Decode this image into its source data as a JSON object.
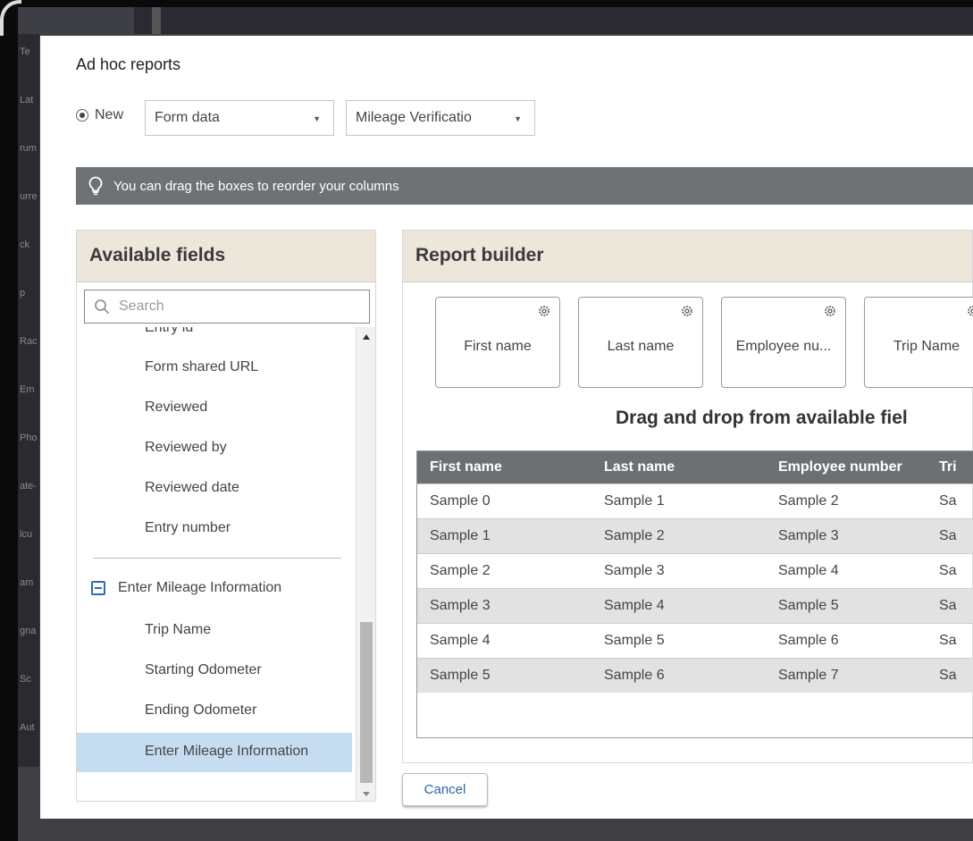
{
  "background_app": {
    "sidebar_items": [
      "Te",
      "Lat",
      "rum",
      "urre",
      "ck",
      "p",
      "Rac",
      "Em",
      "Pho",
      "ate-",
      "lcu",
      "am",
      "gna",
      "Sc",
      "Aut"
    ]
  },
  "dialog": {
    "title": "Ad hoc reports",
    "new_label": "New",
    "report_type_select": "Form data",
    "form_select": "Mileage Verificatio",
    "tip": "You can drag the boxes to reorder your columns"
  },
  "available_fields": {
    "header": "Available fields",
    "search_placeholder": "Search",
    "items": [
      "Entry id",
      "Form shared URL",
      "Reviewed",
      "Reviewed by",
      "Reviewed date",
      "Entry number"
    ],
    "group_label": "Enter Mileage Information",
    "group_items": [
      "Trip Name",
      "Starting Odometer",
      "Ending Odometer",
      "Enter Mileage Information"
    ]
  },
  "report_builder": {
    "header": "Report builder",
    "columns": [
      "First name",
      "Last name",
      "Employee nu...",
      "Trip Name"
    ],
    "drag_message": "Drag and drop from available fiel",
    "table": {
      "headers": [
        "First name",
        "Last name",
        "Employee number",
        "Tri"
      ],
      "rows": [
        [
          "Sample 0",
          "Sample 1",
          "Sample 2",
          "Sa"
        ],
        [
          "Sample 1",
          "Sample 2",
          "Sample 3",
          "Sa"
        ],
        [
          "Sample 2",
          "Sample 3",
          "Sample 4",
          "Sa"
        ],
        [
          "Sample 3",
          "Sample 4",
          "Sample 5",
          "Sa"
        ],
        [
          "Sample 4",
          "Sample 5",
          "Sample 6",
          "Sa"
        ],
        [
          "Sample 5",
          "Sample 6",
          "Sample 7",
          "Sa"
        ]
      ]
    }
  },
  "footer": {
    "cancel_label": "Cancel"
  },
  "colors": {
    "panel_header": "#ece6db",
    "tip_bar": "#6f7275",
    "table_header": "#6d7073",
    "selected_item": "#c6ddf1",
    "link_blue": "#2a68a8"
  }
}
